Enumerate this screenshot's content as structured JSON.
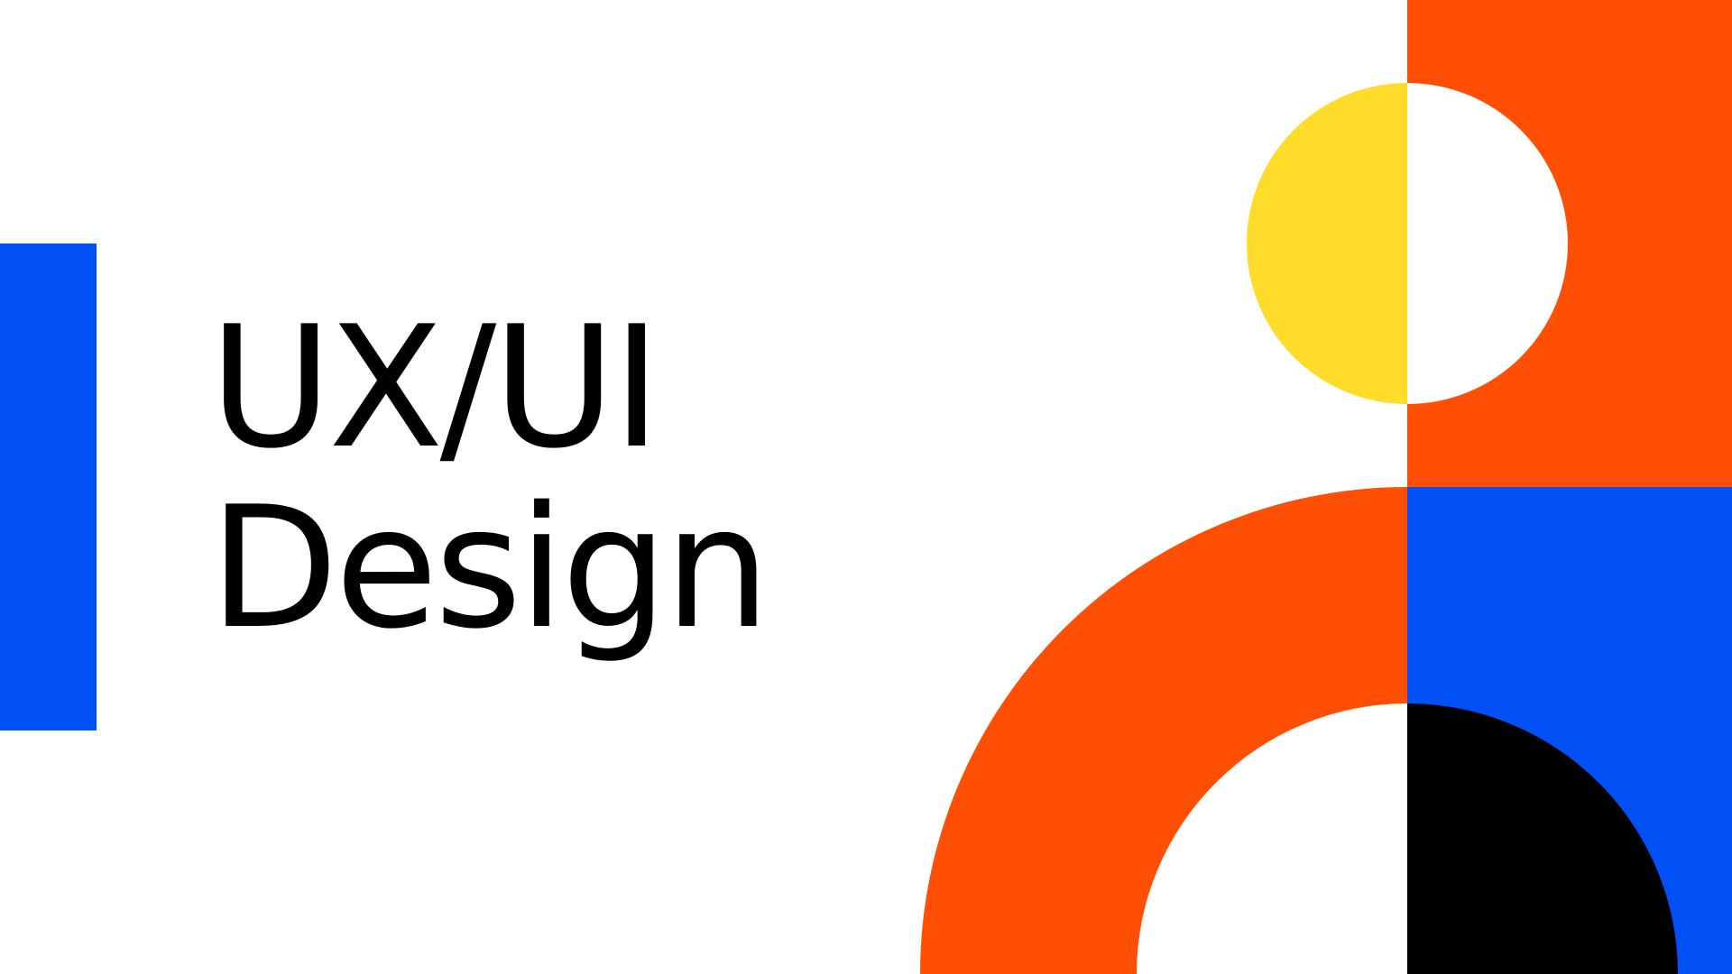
{
  "title": {
    "line1": "UX/UI",
    "line2": "Design"
  },
  "colors": {
    "background": "#ffffff",
    "blue": "#0050F5",
    "orange": "#FF4F04",
    "yellow": "#FFDC2A",
    "black": "#000000",
    "text": "#000000"
  }
}
